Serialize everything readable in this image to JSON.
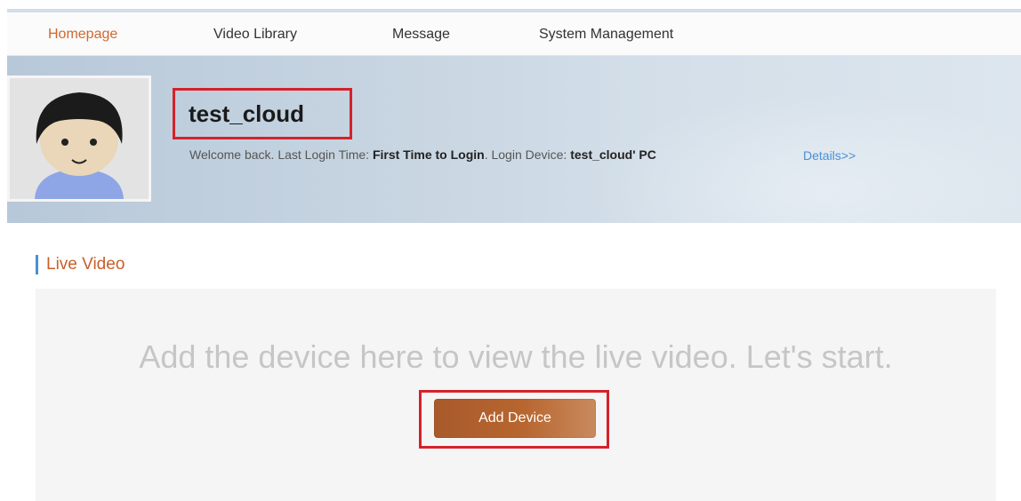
{
  "nav": {
    "items": [
      "Homepage",
      "Video Library",
      "Message",
      "System Management"
    ],
    "active": "Homepage"
  },
  "profile": {
    "username": "test_cloud",
    "welcome_prefix": "Welcome back. Last Login Time:",
    "last_login": "First Time to Login",
    "device_prefix": ". Login Device:",
    "device": "test_cloud' PC",
    "details_link": "Details>>"
  },
  "live_video": {
    "title": "Live Video",
    "empty_message": "Add the device here to view the live video. Let's start.",
    "add_button": "Add Device"
  },
  "colors": {
    "accent": "#c95f29",
    "link": "#4a8fd4",
    "highlight_box": "#d4222a",
    "button": "#b8662f"
  }
}
